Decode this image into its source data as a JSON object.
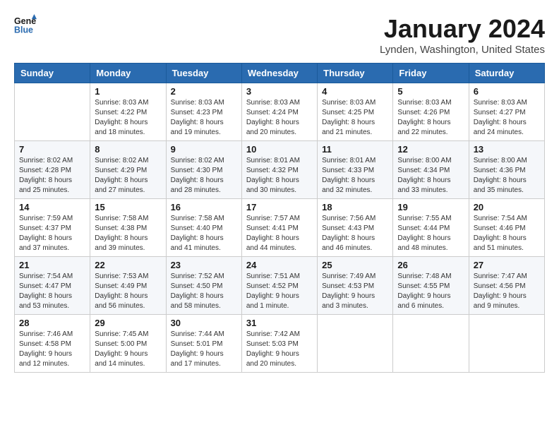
{
  "header": {
    "logo_line1": "General",
    "logo_line2": "Blue",
    "month_title": "January 2024",
    "location": "Lynden, Washington, United States"
  },
  "weekdays": [
    "Sunday",
    "Monday",
    "Tuesday",
    "Wednesday",
    "Thursday",
    "Friday",
    "Saturday"
  ],
  "weeks": [
    [
      {
        "day": "",
        "sunrise": "",
        "sunset": "",
        "daylight": ""
      },
      {
        "day": "1",
        "sunrise": "Sunrise: 8:03 AM",
        "sunset": "Sunset: 4:22 PM",
        "daylight": "Daylight: 8 hours and 18 minutes."
      },
      {
        "day": "2",
        "sunrise": "Sunrise: 8:03 AM",
        "sunset": "Sunset: 4:23 PM",
        "daylight": "Daylight: 8 hours and 19 minutes."
      },
      {
        "day": "3",
        "sunrise": "Sunrise: 8:03 AM",
        "sunset": "Sunset: 4:24 PM",
        "daylight": "Daylight: 8 hours and 20 minutes."
      },
      {
        "day": "4",
        "sunrise": "Sunrise: 8:03 AM",
        "sunset": "Sunset: 4:25 PM",
        "daylight": "Daylight: 8 hours and 21 minutes."
      },
      {
        "day": "5",
        "sunrise": "Sunrise: 8:03 AM",
        "sunset": "Sunset: 4:26 PM",
        "daylight": "Daylight: 8 hours and 22 minutes."
      },
      {
        "day": "6",
        "sunrise": "Sunrise: 8:03 AM",
        "sunset": "Sunset: 4:27 PM",
        "daylight": "Daylight: 8 hours and 24 minutes."
      }
    ],
    [
      {
        "day": "7",
        "sunrise": "Sunrise: 8:02 AM",
        "sunset": "Sunset: 4:28 PM",
        "daylight": "Daylight: 8 hours and 25 minutes."
      },
      {
        "day": "8",
        "sunrise": "Sunrise: 8:02 AM",
        "sunset": "Sunset: 4:29 PM",
        "daylight": "Daylight: 8 hours and 27 minutes."
      },
      {
        "day": "9",
        "sunrise": "Sunrise: 8:02 AM",
        "sunset": "Sunset: 4:30 PM",
        "daylight": "Daylight: 8 hours and 28 minutes."
      },
      {
        "day": "10",
        "sunrise": "Sunrise: 8:01 AM",
        "sunset": "Sunset: 4:32 PM",
        "daylight": "Daylight: 8 hours and 30 minutes."
      },
      {
        "day": "11",
        "sunrise": "Sunrise: 8:01 AM",
        "sunset": "Sunset: 4:33 PM",
        "daylight": "Daylight: 8 hours and 32 minutes."
      },
      {
        "day": "12",
        "sunrise": "Sunrise: 8:00 AM",
        "sunset": "Sunset: 4:34 PM",
        "daylight": "Daylight: 8 hours and 33 minutes."
      },
      {
        "day": "13",
        "sunrise": "Sunrise: 8:00 AM",
        "sunset": "Sunset: 4:36 PM",
        "daylight": "Daylight: 8 hours and 35 minutes."
      }
    ],
    [
      {
        "day": "14",
        "sunrise": "Sunrise: 7:59 AM",
        "sunset": "Sunset: 4:37 PM",
        "daylight": "Daylight: 8 hours and 37 minutes."
      },
      {
        "day": "15",
        "sunrise": "Sunrise: 7:58 AM",
        "sunset": "Sunset: 4:38 PM",
        "daylight": "Daylight: 8 hours and 39 minutes."
      },
      {
        "day": "16",
        "sunrise": "Sunrise: 7:58 AM",
        "sunset": "Sunset: 4:40 PM",
        "daylight": "Daylight: 8 hours and 41 minutes."
      },
      {
        "day": "17",
        "sunrise": "Sunrise: 7:57 AM",
        "sunset": "Sunset: 4:41 PM",
        "daylight": "Daylight: 8 hours and 44 minutes."
      },
      {
        "day": "18",
        "sunrise": "Sunrise: 7:56 AM",
        "sunset": "Sunset: 4:43 PM",
        "daylight": "Daylight: 8 hours and 46 minutes."
      },
      {
        "day": "19",
        "sunrise": "Sunrise: 7:55 AM",
        "sunset": "Sunset: 4:44 PM",
        "daylight": "Daylight: 8 hours and 48 minutes."
      },
      {
        "day": "20",
        "sunrise": "Sunrise: 7:54 AM",
        "sunset": "Sunset: 4:46 PM",
        "daylight": "Daylight: 8 hours and 51 minutes."
      }
    ],
    [
      {
        "day": "21",
        "sunrise": "Sunrise: 7:54 AM",
        "sunset": "Sunset: 4:47 PM",
        "daylight": "Daylight: 8 hours and 53 minutes."
      },
      {
        "day": "22",
        "sunrise": "Sunrise: 7:53 AM",
        "sunset": "Sunset: 4:49 PM",
        "daylight": "Daylight: 8 hours and 56 minutes."
      },
      {
        "day": "23",
        "sunrise": "Sunrise: 7:52 AM",
        "sunset": "Sunset: 4:50 PM",
        "daylight": "Daylight: 8 hours and 58 minutes."
      },
      {
        "day": "24",
        "sunrise": "Sunrise: 7:51 AM",
        "sunset": "Sunset: 4:52 PM",
        "daylight": "Daylight: 9 hours and 1 minute."
      },
      {
        "day": "25",
        "sunrise": "Sunrise: 7:49 AM",
        "sunset": "Sunset: 4:53 PM",
        "daylight": "Daylight: 9 hours and 3 minutes."
      },
      {
        "day": "26",
        "sunrise": "Sunrise: 7:48 AM",
        "sunset": "Sunset: 4:55 PM",
        "daylight": "Daylight: 9 hours and 6 minutes."
      },
      {
        "day": "27",
        "sunrise": "Sunrise: 7:47 AM",
        "sunset": "Sunset: 4:56 PM",
        "daylight": "Daylight: 9 hours and 9 minutes."
      }
    ],
    [
      {
        "day": "28",
        "sunrise": "Sunrise: 7:46 AM",
        "sunset": "Sunset: 4:58 PM",
        "daylight": "Daylight: 9 hours and 12 minutes."
      },
      {
        "day": "29",
        "sunrise": "Sunrise: 7:45 AM",
        "sunset": "Sunset: 5:00 PM",
        "daylight": "Daylight: 9 hours and 14 minutes."
      },
      {
        "day": "30",
        "sunrise": "Sunrise: 7:44 AM",
        "sunset": "Sunset: 5:01 PM",
        "daylight": "Daylight: 9 hours and 17 minutes."
      },
      {
        "day": "31",
        "sunrise": "Sunrise: 7:42 AM",
        "sunset": "Sunset: 5:03 PM",
        "daylight": "Daylight: 9 hours and 20 minutes."
      },
      {
        "day": "",
        "sunrise": "",
        "sunset": "",
        "daylight": ""
      },
      {
        "day": "",
        "sunrise": "",
        "sunset": "",
        "daylight": ""
      },
      {
        "day": "",
        "sunrise": "",
        "sunset": "",
        "daylight": ""
      }
    ]
  ]
}
